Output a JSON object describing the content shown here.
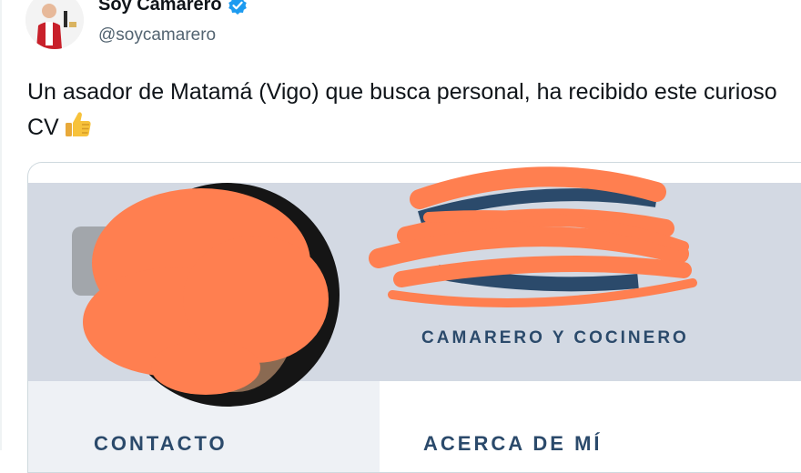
{
  "author": {
    "display_name": "Soy Camarero",
    "handle": "@soycamarero",
    "verified_icon": "verified-badge-icon",
    "accent": "#1d9bf0"
  },
  "tweet": {
    "text": "Un asador de Matamá (Vigo) que busca personal, ha recibido este curioso CV",
    "emoji": "thumbs-up-icon"
  },
  "cv": {
    "role": "CAMARERO Y COCINERO",
    "section_contact": "CONTACTO",
    "section_about": "ACERCA DE MÍ",
    "redaction_color": "#ff7f50",
    "header_color": "#d3d9e3",
    "text_color": "#2b4a6b"
  }
}
